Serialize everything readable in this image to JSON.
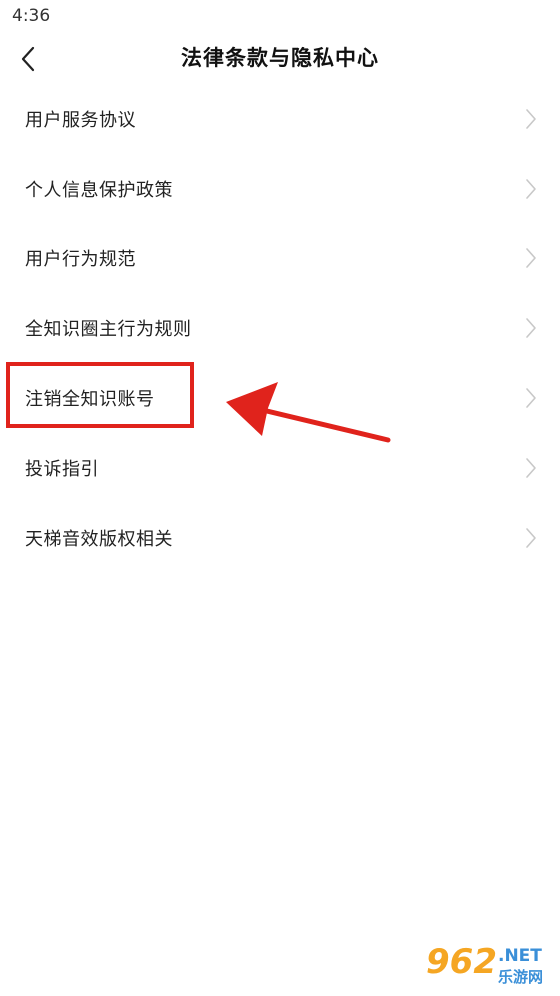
{
  "status_bar": {
    "time": "4:36"
  },
  "nav": {
    "title": "法律条款与隐私中心",
    "back_icon": "chevron-left-icon"
  },
  "menu": {
    "items": [
      {
        "label": "用户服务协议"
      },
      {
        "label": "个人信息保护政策"
      },
      {
        "label": "用户行为规范"
      },
      {
        "label": "全知识圈主行为规则"
      },
      {
        "label": "注销全知识账号"
      },
      {
        "label": "投诉指引"
      },
      {
        "label": "天梯音效版权相关"
      }
    ],
    "chevron_icon": "chevron-right-icon"
  },
  "annotation": {
    "highlight_color": "#e0231c",
    "highlighted_item_index": 4
  },
  "watermark": {
    "number": "962",
    "net": ".NET",
    "site": "乐游网"
  },
  "colors": {
    "background": "#ffffff",
    "text": "#222222",
    "chevron": "#c8c8c8"
  }
}
